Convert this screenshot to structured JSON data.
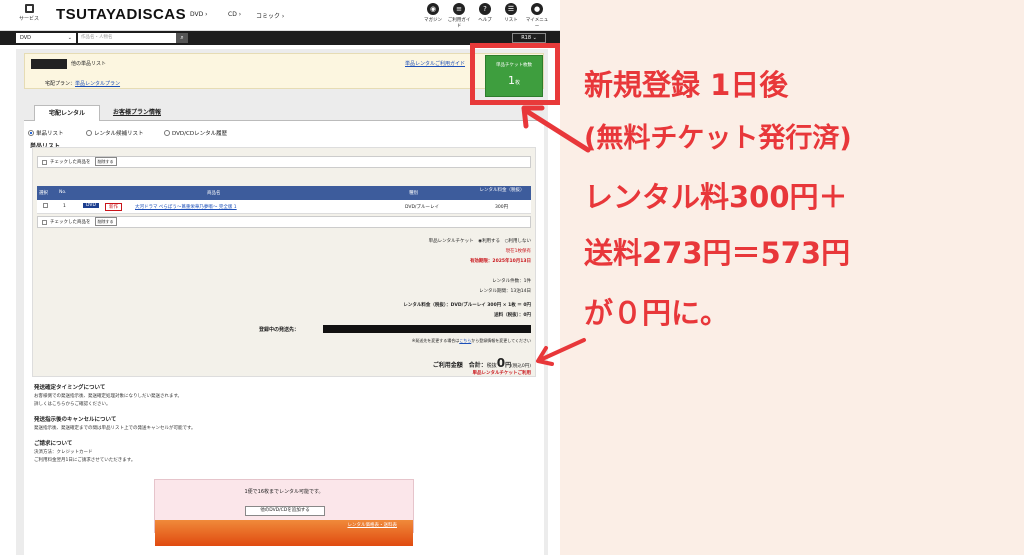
{
  "header": {
    "service_label": "サービス",
    "logo": "TSUTAYADISCAS",
    "nav": [
      "DVD",
      "CD",
      "コミック"
    ],
    "icons": [
      {
        "label": "マガジン",
        "icon": "magazine-icon"
      },
      {
        "label": "ご利用ガイド",
        "icon": "guide-icon"
      },
      {
        "label": "ヘルプ",
        "icon": "help-icon"
      },
      {
        "label": "リスト",
        "icon": "list-icon"
      },
      {
        "label": "マイメニュー",
        "icon": "mymenu-icon"
      }
    ]
  },
  "search": {
    "category": "DVD",
    "placeholder": "作品名・人物名",
    "r18": "R18"
  },
  "info": {
    "list_name": "他の単品リスト",
    "plan_label": "宅配プラン：",
    "plan_value": "単品レンタルプラン",
    "guide_link": "単品レンタルご利用ガイド"
  },
  "ticket": {
    "label": "単品チケット枚数",
    "count": "1",
    "unit": "枚"
  },
  "tabs": [
    "宅配レンタル",
    "お客様プラン情報"
  ],
  "radios": [
    "単品リスト",
    "レンタル候補リスト",
    "DVD/CDレンタル履歴"
  ],
  "section_title": "単品リスト",
  "check_row": {
    "text": "チェックした商品を",
    "button": "削除する"
  },
  "table": {
    "headers": [
      "選択",
      "No.",
      "商品名",
      "種別",
      "レンタル料金（税抜）"
    ],
    "rows": [
      {
        "no": "1",
        "badge_type": "DVD",
        "badge_new": "新作",
        "title": "大河ドラマ べらぼう～蔦重栄華乃夢噺～ 完全版 1",
        "kind": "DVD/ブルーレイ",
        "price": "300円"
      }
    ]
  },
  "ticket_use": {
    "label": "単品レンタルチケット",
    "opt_use": "利用する",
    "opt_not": "利用しない",
    "held": "現在1枚保有",
    "expiry": "有効期限：2025年10月13日"
  },
  "counts": {
    "count": "レンタル件数：1件",
    "period": "レンタル期間：13泊14日"
  },
  "fees": {
    "rental": "レンタル料金（税抜）：DVD/ブルーレイ 300円 × 1枚 ＝ 0円",
    "shipping": "送料（税抜）：0円"
  },
  "address": {
    "label": "登録中の発送先：",
    "note_prefix": "※発送先を変更する場合は",
    "note_link": "こちら",
    "note_suffix": "から登録情報を変更してください"
  },
  "total": {
    "label": "ご利用金額　合計：",
    "tax_label": "税抜",
    "amount": "0",
    "unit": "円",
    "tax_in": "(税込0円)",
    "ticket_note": "単品レンタルチケットご利用"
  },
  "notes": [
    {
      "title": "発送確定タイミングについて",
      "lines": [
        "お客様側での発送指示後、発送確定処理対象になりしだい発送されます。",
        "詳しくはこちらからご確認ください。"
      ]
    },
    {
      "title": "発送指示後のキャンセルについて",
      "lines": [
        "発送指示後、発送確定までの間は単品リスト上での発送キャンセルが可能です。"
      ]
    },
    {
      "title": "ご請求について",
      "lines": [
        "決済方法：クレジットカード",
        "ご利用料金翌月1日にご請求させていただきます。"
      ]
    }
  ],
  "add_box": {
    "message": "1便で16枚までレンタル可能です。",
    "button": "他のDVD/CDを追加する",
    "link": "レンタル価格表・送料表"
  },
  "annotation": [
    "新規登録 1日後",
    "(無料チケット発行済)",
    "レンタル料300円＋",
    "送料273円＝573円",
    "が０円に。"
  ],
  "colors": {
    "accent": "#e8373a",
    "ticket_green": "#3e9e3e",
    "table_header": "#3d5c9c",
    "annotation_bg": "#fbeee6"
  }
}
